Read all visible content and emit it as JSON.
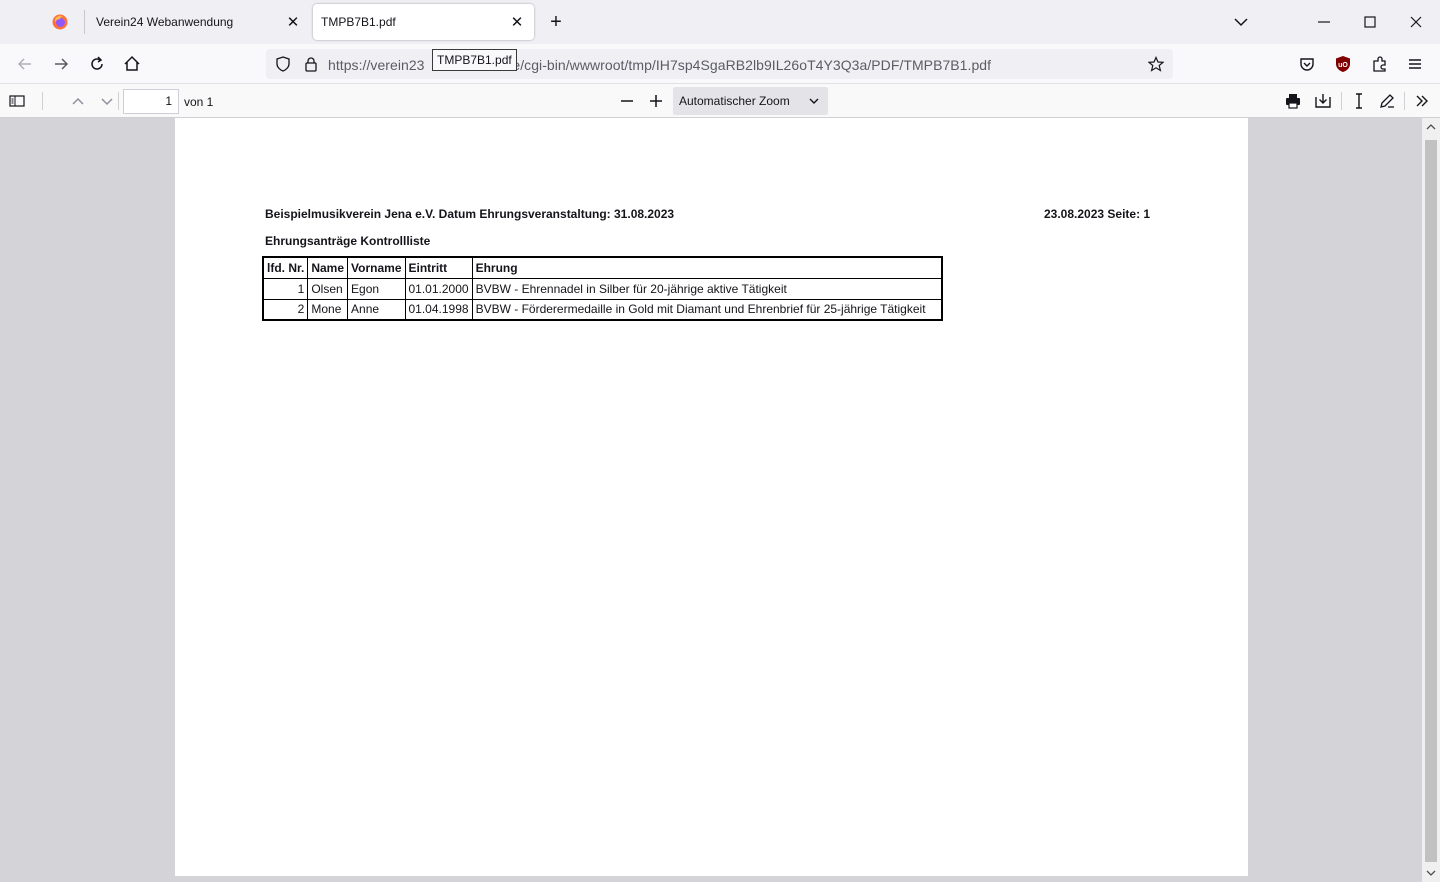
{
  "tabs": [
    {
      "title": "Verein24 Webanwendung",
      "active": false
    },
    {
      "title": "TMPB7B1.pdf",
      "active": true
    }
  ],
  "tooltip": "TMPB7B1.pdf",
  "url": {
    "prefix": "https://verein23",
    "suffix": "de/cgi-bin/wwwroot/tmp/IH7sp4SgaRB2lb9IL26oT4Y3Q3a/PDF/TMPB7B1.pdf"
  },
  "pdf_toolbar": {
    "page_number": "1",
    "page_count": "von 1",
    "zoom": "Automatischer Zoom"
  },
  "document": {
    "header_left": "Beispielmusikverein Jena e.V. Datum Ehrungsveranstaltung: 31.08.2023",
    "header_right": "23.08.2023 Seite: 1",
    "subtitle": "Ehrungsanträge Kontrollliste",
    "table": {
      "columns": [
        "lfd. Nr.",
        "Name",
        "Vorname",
        "Eintritt",
        "Ehrung"
      ],
      "rows": [
        [
          "1",
          "Olsen",
          "Egon",
          "01.01.2000",
          "BVBW - Ehrennadel in Silber für 20-jährige aktive Tätigkeit"
        ],
        [
          "2",
          "Mone",
          "Anne",
          "01.04.1998",
          "BVBW - Förderermedaille in Gold mit Diamant und Ehrenbrief für 25-jährige Tätigkeit"
        ]
      ]
    }
  },
  "colors": {
    "accent": "#0060df",
    "ublock": "#800000"
  }
}
